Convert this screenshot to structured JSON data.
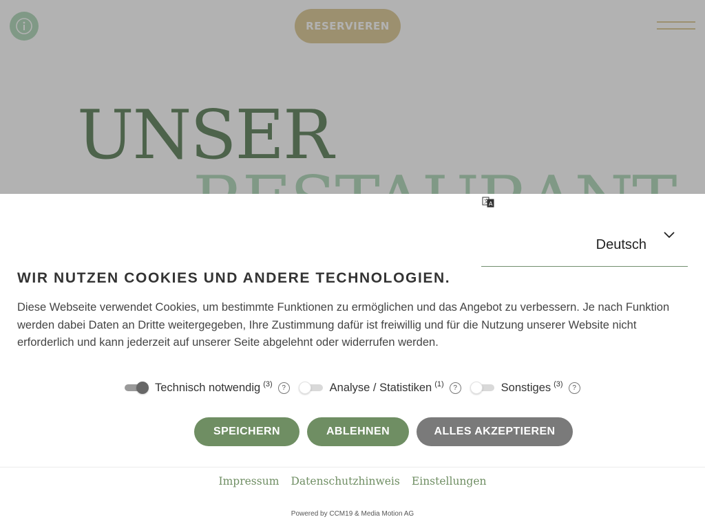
{
  "header": {
    "reserve_label": "RESERVIEREN"
  },
  "hero": {
    "line1": "UNSER",
    "line2": "RESTAURANT"
  },
  "colors": {
    "accent_green": "#6f8e63",
    "accent_gold": "#e0cfa0",
    "button_grey": "#7a7a7a"
  },
  "cookie_banner": {
    "language": {
      "selected": "Deutsch"
    },
    "title": "WIR NUTZEN COOKIES UND ANDERE TECHNOLOGIEN.",
    "body": "Diese Webseite verwendet Cookies, um bestimmte Funktionen zu ermöglichen und das Angebot zu verbessern. Je nach Funktion werden dabei Daten an Dritte weitergegeben, Ihre Zustimmung dafür ist freiwillig und für die Nutzung unserer Website nicht erforderlich und kann jederzeit auf unserer Seite abgelehnt oder widerrufen werden.",
    "toggles": [
      {
        "label": "Technisch notwendig",
        "count": "(3)",
        "state": "on"
      },
      {
        "label": "Analyse / Statistiken",
        "count": "(1)",
        "state": "off"
      },
      {
        "label": "Sonstiges",
        "count": "(3)",
        "state": "off"
      }
    ],
    "help_glyph": "?",
    "buttons": {
      "save": "SPEICHERN",
      "decline": "ABLEHNEN",
      "accept_all": "ALLES AKZEPTIEREN"
    },
    "footer_links": {
      "imprint": "Impressum",
      "privacy": "Datenschutzhinweis",
      "settings": "Einstellungen"
    },
    "powered_by": "Powered by CCM19 & Media Motion AG"
  }
}
